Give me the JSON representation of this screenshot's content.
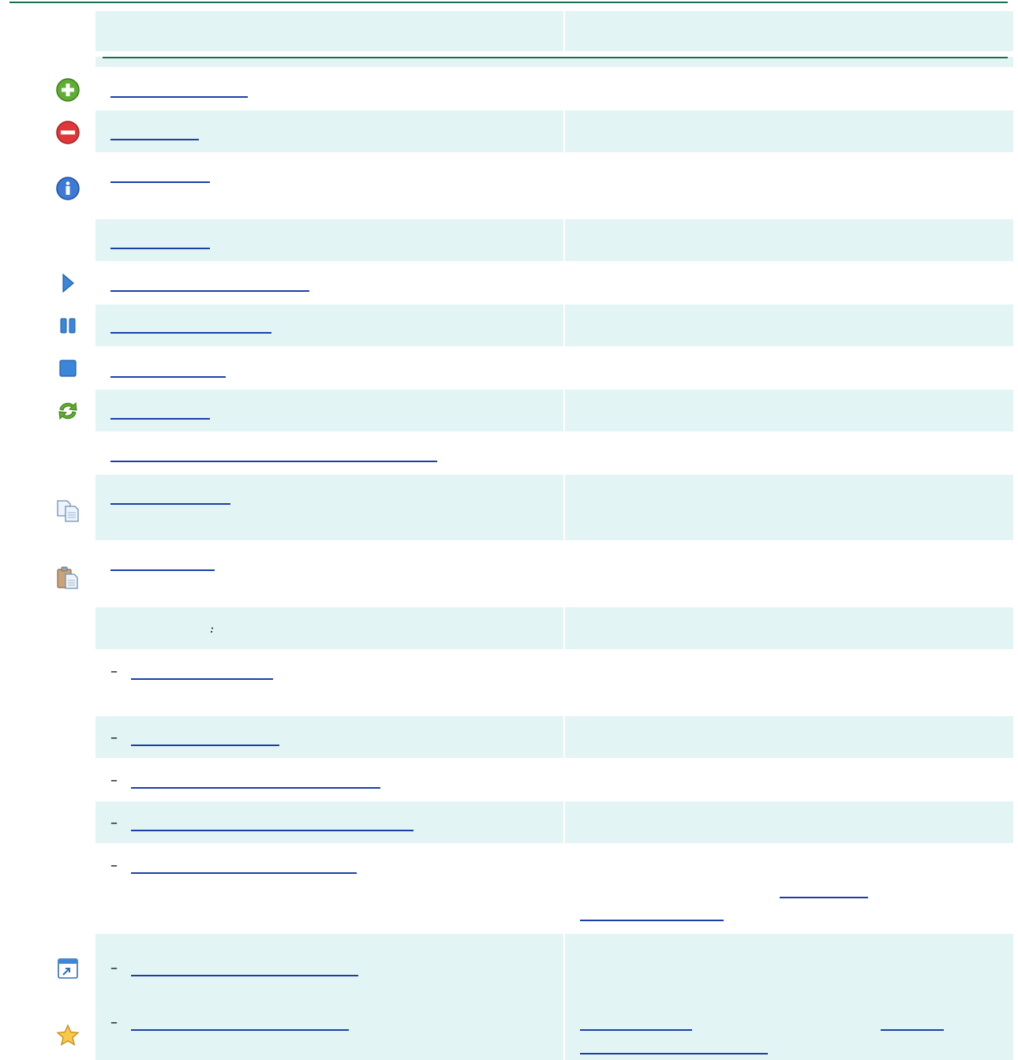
{
  "table": {
    "header": {
      "col1": "",
      "col2": ""
    },
    "section_label": {
      "text": "",
      "suffix": ":"
    },
    "rows": [
      {
        "id": "add",
        "icon": "add-icon",
        "label": "",
        "description": ""
      },
      {
        "id": "remove",
        "icon": "remove-icon",
        "label": "",
        "description": ""
      },
      {
        "id": "info",
        "icon": "info-icon",
        "label": "",
        "description": ""
      },
      {
        "id": "plain1",
        "icon": "",
        "label": "",
        "description": ""
      },
      {
        "id": "play",
        "icon": "play-icon",
        "label": "",
        "description": ""
      },
      {
        "id": "pause",
        "icon": "pause-icon",
        "label": "",
        "description": ""
      },
      {
        "id": "stop",
        "icon": "stop-icon",
        "label": "",
        "description": ""
      },
      {
        "id": "refresh",
        "icon": "refresh-icon",
        "label": "",
        "description": ""
      },
      {
        "id": "plain2",
        "icon": "",
        "label": "",
        "description": ""
      },
      {
        "id": "copy",
        "icon": "copy-icon",
        "label": "",
        "description": ""
      },
      {
        "id": "paste",
        "icon": "paste-icon",
        "label": "",
        "description": ""
      }
    ],
    "sub_rows": [
      {
        "id": "sub1",
        "dash": "–",
        "icon": "",
        "label": "",
        "description": ""
      },
      {
        "id": "sub2",
        "dash": "–",
        "icon": "",
        "label": "",
        "description": ""
      },
      {
        "id": "sub3",
        "dash": "–",
        "icon": "",
        "label": "",
        "description": ""
      },
      {
        "id": "sub4",
        "dash": "–",
        "icon": "",
        "label": "",
        "description": ""
      },
      {
        "id": "sub5",
        "dash": "–",
        "icon": "",
        "label": "",
        "description": "",
        "desc_links": [
          "",
          ""
        ]
      },
      {
        "id": "sub6",
        "dash": "–",
        "icon": "open-window-icon",
        "label": "",
        "description": ""
      },
      {
        "id": "sub7",
        "dash": "–",
        "icon": "star-icon",
        "label": "",
        "description": "",
        "desc_links": [
          "",
          "",
          ""
        ]
      }
    ]
  },
  "colors": {
    "rule": "#196e4f",
    "row_shade": "#e3f4f4",
    "link": "#1a3ea8"
  }
}
